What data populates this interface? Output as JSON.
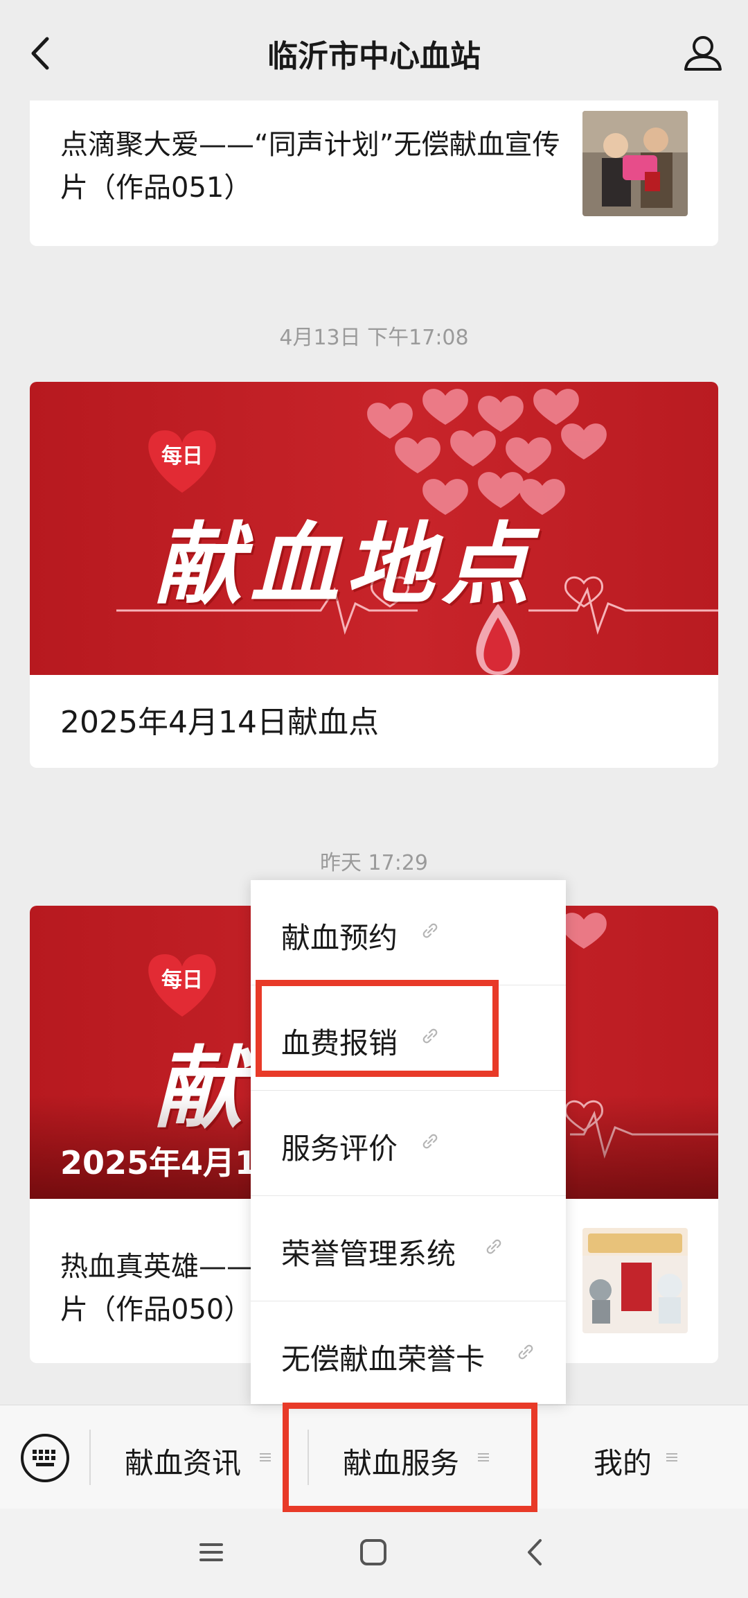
{
  "header": {
    "title": "临沂市中心血站"
  },
  "messages": [
    {
      "title": "点滴聚大爱——“同声计划”无偿献血宣传片（作品051）"
    },
    {
      "timestamp": "4月13日 下午17:08",
      "banner_badge": "每日",
      "banner_title": "献血地点",
      "caption": "2025年4月14日献血点"
    },
    {
      "timestamp": "昨天 17:29",
      "banner_badge": "每日",
      "banner_title": "献血地点",
      "banner_overlay": "2025年4月15日献血点",
      "title": "热血真英雄——“同声计划”无偿献血宣传片（作品050）"
    }
  ],
  "popup_menu": {
    "items": [
      {
        "label": "献血预约"
      },
      {
        "label": "血费报销"
      },
      {
        "label": "服务评价"
      },
      {
        "label": "荣誉管理系统"
      },
      {
        "label": "无偿献血荣誉卡"
      }
    ]
  },
  "bottom_menu": {
    "items": [
      {
        "label": "献血资讯"
      },
      {
        "label": "献血服务"
      },
      {
        "label": "我的"
      }
    ]
  },
  "colors": {
    "banner_red": "#c8242a",
    "highlight": "#e83a28",
    "background": "#ededed"
  }
}
